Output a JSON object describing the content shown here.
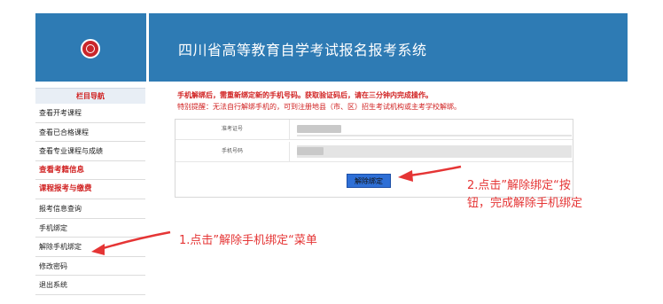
{
  "header": {
    "site_title": "四川省高等教育自学考试报名报考系统"
  },
  "sidebar": {
    "heading": "栏目导航",
    "items": [
      {
        "label": "查看开考课程",
        "style": "normal"
      },
      {
        "label": "查看已合格课程",
        "style": "normal"
      },
      {
        "label": "查看专业课程与成绩",
        "style": "normal"
      },
      {
        "label": "查看考籍信息",
        "style": "red"
      },
      {
        "label": "课程报考与缴费",
        "style": "red"
      },
      {
        "label": "报考信息查询",
        "style": "normal"
      },
      {
        "label": "手机绑定",
        "style": "normal"
      },
      {
        "label": "解除手机绑定",
        "style": "normal"
      },
      {
        "label": "修改密码",
        "style": "normal"
      },
      {
        "label": "退出系统",
        "style": "normal"
      }
    ]
  },
  "main": {
    "notice_1": "手机解绑后，需重新绑定新的手机号码。获取验证码后，请在三分钟内完成操作。",
    "notice_2": "特别提醒：无法自行解绑手机的，可到注册地县（市、区）招生考试机构或主考学校解绑。",
    "form": {
      "rows": [
        {
          "label": "准考证号"
        },
        {
          "label": "手机号码"
        }
      ],
      "unbind_button": "解除绑定"
    }
  },
  "annotations": {
    "step1": "1.点击”解除手机绑定“菜单",
    "step2_line1": "2.点击”解除绑定“按",
    "step2_line2": "钮，完成解除手机绑定"
  },
  "colors": {
    "header_bg": "#2e7bb4",
    "accent_red": "#d02020",
    "annotation_red": "#e53535"
  }
}
